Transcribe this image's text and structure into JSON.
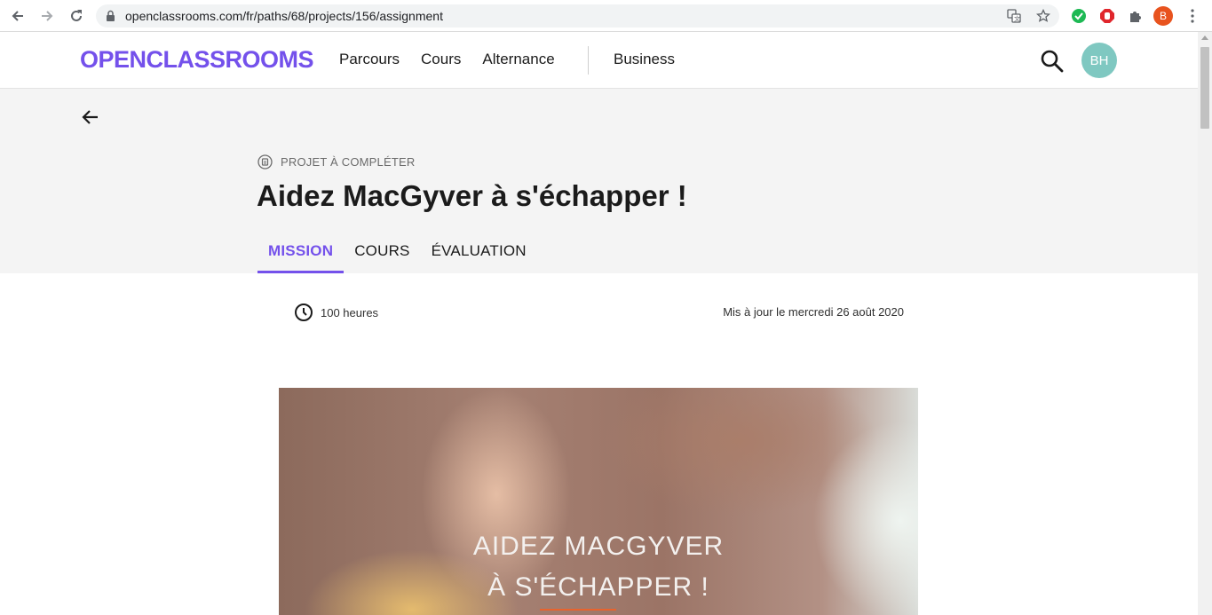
{
  "browser": {
    "url": "openclassrooms.com/fr/paths/68/projects/156/assignment",
    "profile_initial": "B",
    "icons": [
      "back-icon",
      "forward-icon",
      "reload-icon",
      "lock-icon",
      "translate-icon",
      "star-icon",
      "check-extension-icon",
      "adblock-extension-icon",
      "puzzle-icon",
      "kebab-menu-icon"
    ]
  },
  "header": {
    "logo": "OPENCLASSROOMS",
    "nav": [
      "Parcours",
      "Cours",
      "Alternance"
    ],
    "business": "Business",
    "avatar_initials": "BH"
  },
  "hero": {
    "kicker": "PROJET À COMPLÉTER",
    "title": "Aidez MacGyver à s'échapper !",
    "tabs": [
      {
        "label": "MISSION",
        "active": true
      },
      {
        "label": "COURS",
        "active": false
      },
      {
        "label": "ÉVALUATION",
        "active": false
      }
    ]
  },
  "meta": {
    "duration": "100 heures",
    "updated": "Mis à jour le mercredi 26 août 2020"
  },
  "banner": {
    "line1": "AIDEZ MACGYVER",
    "line2": "À S'ÉCHAPPER !"
  },
  "colors": {
    "brand": "#7451eb",
    "avatar": "#7fc8c1",
    "hero_bg": "#f4f4f4",
    "accent_orange": "#e8632d"
  }
}
